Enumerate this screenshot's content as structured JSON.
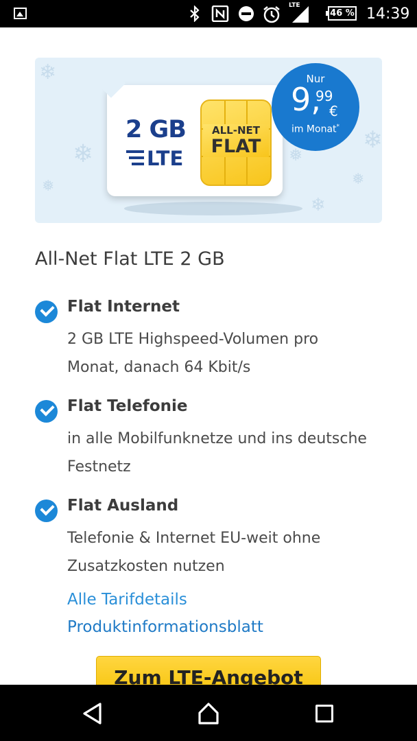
{
  "status_bar": {
    "time": "14:39",
    "battery": "46 %",
    "network": "LTE",
    "icons": [
      "gallery-icon",
      "bluetooth-icon",
      "nfc-icon",
      "do-not-disturb-icon",
      "alarm-icon",
      "signal-icon",
      "battery-icon"
    ]
  },
  "banner": {
    "sim_data": "2 GB",
    "sim_lte": "LTE",
    "chip_line1": "ALL-NET",
    "chip_line2": "FLAT",
    "price_prefix": "Nur",
    "price_int": "9,",
    "price_dec": "99",
    "price_currency": "€",
    "price_period": "im Monat",
    "price_footnote": "*"
  },
  "tariff": {
    "title": "All-Net Flat LTE 2 GB",
    "features": [
      {
        "title": "Flat Internet",
        "desc": "2 GB LTE Highspeed-Volumen pro Monat, danach 64 Kbit/s"
      },
      {
        "title": "Flat Telefonie",
        "desc": "in alle Mobilfunknetze und ins deutsche Festnetz"
      },
      {
        "title": "Flat Ausland",
        "desc": "Telefonie & Internet EU-weit ohne Zusatzkosten nutzen"
      }
    ],
    "links": {
      "details": "Alle Tarifdetails",
      "info_sheet": "Produktinformationsblatt"
    },
    "cta": "Zum LTE-Angebot"
  },
  "colors": {
    "accent_blue": "#1c88d8",
    "link_blue": "#2a8fd8",
    "cta_yellow": "#f5c000",
    "banner_bg": "#e3f0f9"
  }
}
